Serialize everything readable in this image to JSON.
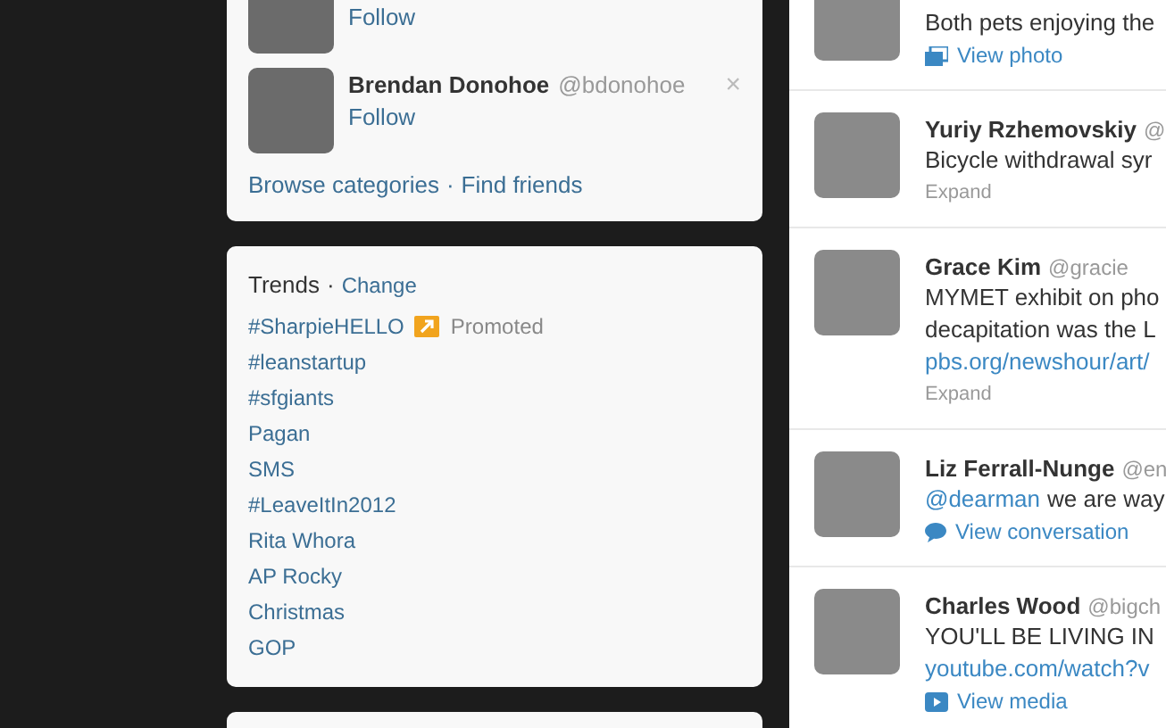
{
  "suggestions": {
    "people": [
      {
        "action": "Follow"
      },
      {
        "name": "Brendan Donohoe",
        "handle": "@bdonohoe",
        "action": "Follow",
        "dismiss": "×"
      }
    ],
    "links": [
      "Browse categories",
      "Find friends"
    ],
    "separator": "·"
  },
  "trends": {
    "title": "Trends",
    "separator": "·",
    "change": "Change",
    "items": [
      {
        "label": "#SharpieHELLO",
        "promoted": "Promoted"
      },
      {
        "label": "#leanstartup"
      },
      {
        "label": "#sfgiants"
      },
      {
        "label": "Pagan"
      },
      {
        "label": "SMS"
      },
      {
        "label": "#LeaveItIn2012"
      },
      {
        "label": "Rita Whora"
      },
      {
        "label": "AP Rocky"
      },
      {
        "label": "Christmas"
      },
      {
        "label": "GOP"
      }
    ]
  },
  "tweets": [
    {
      "lines": [
        {
          "kind": "text",
          "text": "Both pets enjoying the"
        }
      ],
      "action": {
        "kind": "photo",
        "label": "View photo"
      }
    },
    {
      "name": "Yuriy Rzhemovskiy",
      "handle": "@",
      "lines": [
        {
          "kind": "text",
          "text": "Bicycle withdrawal syr"
        }
      ],
      "action": {
        "kind": "expand",
        "label": "Expand"
      }
    },
    {
      "name": "Grace Kim",
      "handle": "@gracie",
      "lines": [
        {
          "kind": "text",
          "text": "MYMET exhibit on pho"
        },
        {
          "kind": "text",
          "text": "decapitation was the L"
        },
        {
          "kind": "link",
          "text": "pbs.org/newshour/art/"
        }
      ],
      "action": {
        "kind": "expand",
        "label": "Expand"
      }
    },
    {
      "name": "Liz Ferrall-Nunge",
      "handle": "@en",
      "lines": [
        {
          "kind": "mention",
          "mention": "@dearman",
          "text": "we are way"
        }
      ],
      "action": {
        "kind": "conversation",
        "label": "View conversation"
      }
    },
    {
      "name": "Charles Wood",
      "handle": "@bigch",
      "lines": [
        {
          "kind": "text",
          "text": "YOU'LL BE LIVING IN"
        },
        {
          "kind": "link",
          "text": "youtube.com/watch?v"
        }
      ],
      "action": {
        "kind": "media",
        "label": "View media"
      }
    }
  ]
}
